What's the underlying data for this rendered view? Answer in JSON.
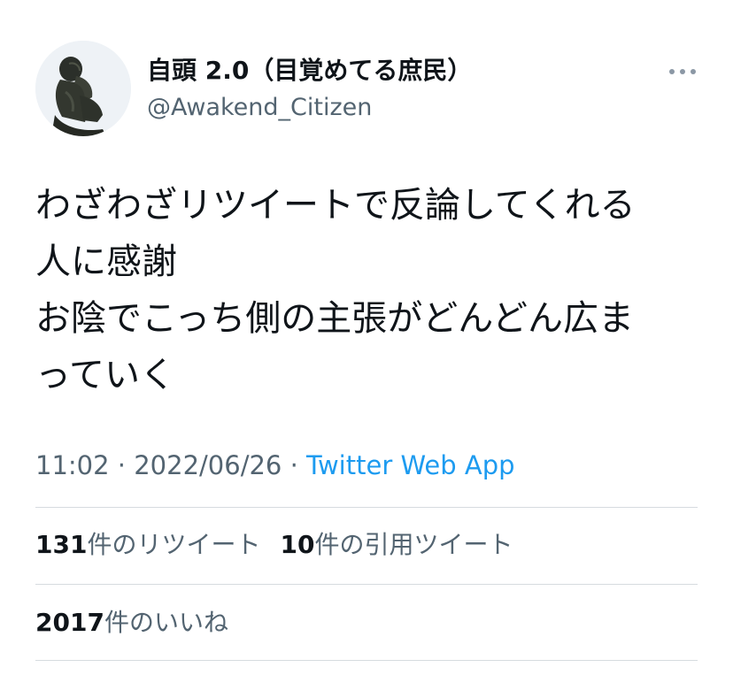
{
  "user": {
    "display_name": "自頭 2.0（目覚めてる庶民）",
    "handle": "@Awakend_Citizen"
  },
  "tweet": {
    "lines": [
      "わざわざリツイートで反論してくれる",
      "人に感謝",
      "お陰でこっち側の主張がどんどん広ま",
      "っていく"
    ],
    "time": "11:02",
    "separator": " · ",
    "date": "2022/06/26",
    "source": "Twitter Web App"
  },
  "stats": {
    "retweets_count": "131",
    "retweets_label": "件のリツイート",
    "quotes_count": "10",
    "quotes_label": "件の引用ツイート",
    "likes_count": "2017",
    "likes_label": "件のいいね"
  },
  "colors": {
    "text": "#0f1419",
    "secondary": "#536471",
    "link": "#1d9bf0",
    "divider": "#d6dbdf"
  },
  "icons": {
    "more": "more-horizontal-icon"
  }
}
